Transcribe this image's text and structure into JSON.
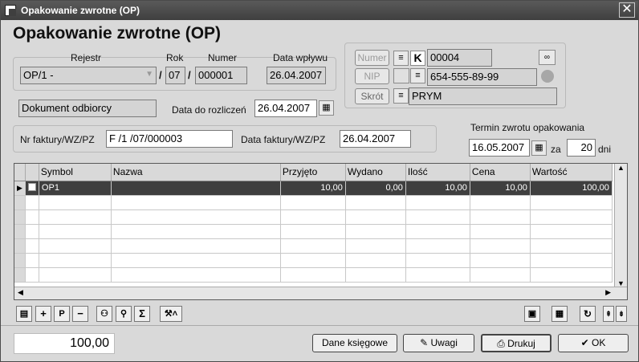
{
  "window": {
    "title": "Opakowanie zwrotne (OP)"
  },
  "header": {
    "title": "Opakowanie zwrotne (OP)"
  },
  "register": {
    "rejestr_label": "Rejestr",
    "rok_label": "Rok",
    "numer_label": "Numer",
    "data_wplywu_label": "Data wpływu",
    "rejestr_value": "OP/1  -",
    "rok_value": "07",
    "numer_value": "000001",
    "data_wplywu_value": "26.04.2007",
    "sep1": "/",
    "sep2": "/"
  },
  "doc": {
    "type_value": "Dokument odbiorcy",
    "data_do_rozliczen_label": "Data do rozliczeń",
    "data_do_rozliczen_value": "26.04.2007",
    "nr_faktury_label": "Nr faktury/WZ/PZ",
    "nr_faktury_value": "F /1  /07/000003",
    "data_faktury_label": "Data faktury/WZ/PZ",
    "data_faktury_value": "26.04.2007"
  },
  "contractor": {
    "numer_button": "Numer",
    "nip_button": "NIP",
    "skrot_button": "Skrót",
    "k_label": "K",
    "numer_value": "00004",
    "nip_value": "654-555-89-99",
    "skrot_value": "PRYM"
  },
  "return_term": {
    "label": "Termin zwrotu  opakowania",
    "date_value": "16.05.2007",
    "za_label": "za",
    "days_value": "20",
    "days_label": "dni"
  },
  "grid": {
    "columns": [
      "Symbol",
      "Nazwa",
      "Przyjęto",
      "Wydano",
      "Ilość",
      "Cena",
      "Wartość"
    ],
    "rows": [
      {
        "symbol": "OP1",
        "nazwa": "",
        "przyjeto": "10,00",
        "wydano": "0,00",
        "ilosc": "10,00",
        "cena": "10,00",
        "wartosc": "100,00"
      }
    ]
  },
  "footer": {
    "total": "100,00",
    "dane_ksiegowe": "Dane księgowe",
    "uwagi": "Uwagi",
    "drukuj": "Drukuj",
    "ok": "OK"
  }
}
